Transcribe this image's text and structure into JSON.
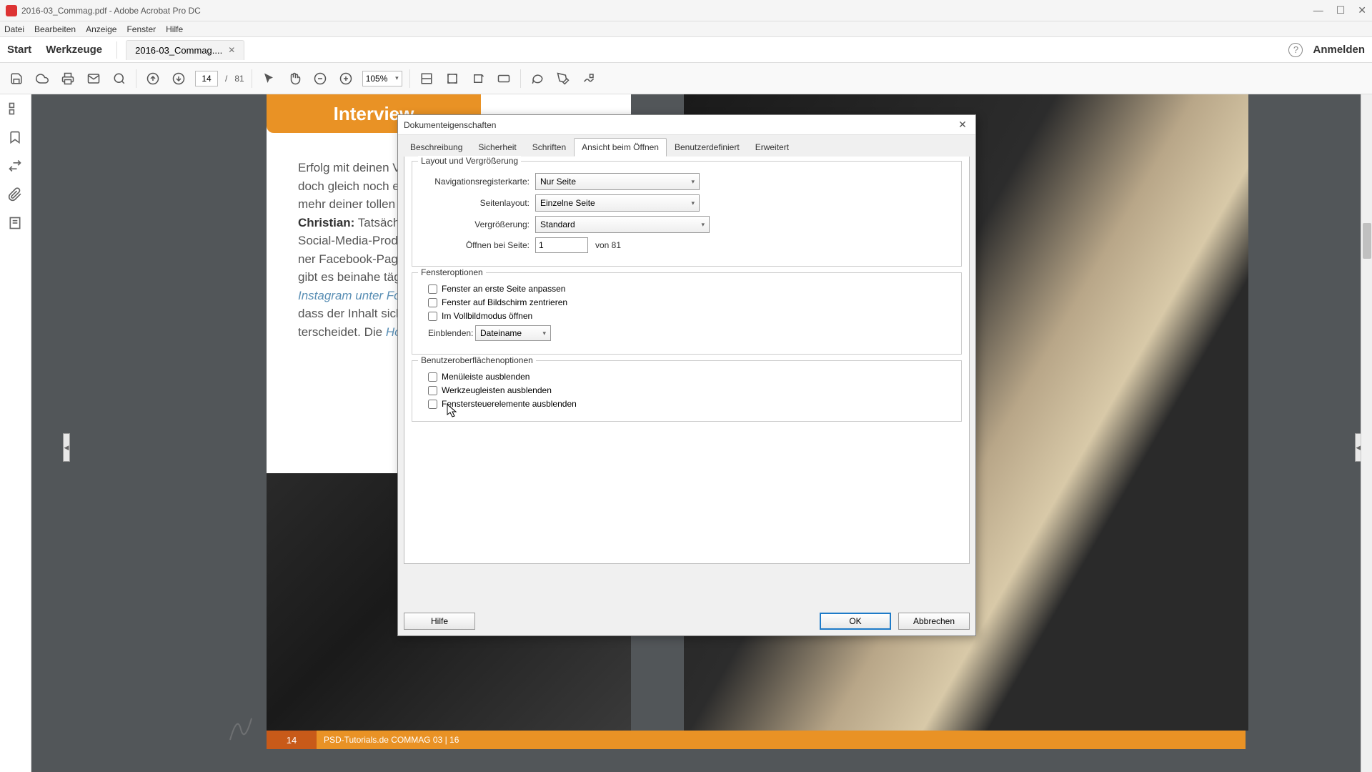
{
  "app": {
    "title": "2016-03_Commag.pdf - Adobe Acrobat Pro DC",
    "menubar": [
      "Datei",
      "Bearbeiten",
      "Anzeige",
      "Fenster",
      "Hilfe"
    ],
    "toptabs": {
      "start": "Start",
      "tools": "Werkzeuge",
      "file_tab": "2016-03_Commag....",
      "signin": "Anmelden"
    }
  },
  "toolbar": {
    "page_current": "14",
    "page_sep": "/",
    "page_total": "81",
    "zoom": "105%"
  },
  "page": {
    "tab_label": "Interview",
    "body_lines": [
      "Erfolg mit deinen Vierbeine",
      "doch gleich noch etwas W",
      "mehr deiner tollen Bilder s"
    ],
    "author_label": "Christian:",
    "after_author": " Tatsächlich ist „F",
    "lines2": [
      "Social-Media-Produkt. Am a",
      "ner Facebook-Page unter",
      "gibt es beinahe täglich neu"
    ],
    "link1": "Instagram unter FotosFreiS",
    "after_link1_a": "dass der Inhalt sich hier nicl",
    "after_link1_b": "terscheidet. Die ",
    "link2": "Homepage",
    "footer_page": "14",
    "footer_bar": "PSD-Tutorials.de   COMMAG 03 | 16"
  },
  "dialog": {
    "title": "Dokumenteigenschaften",
    "tabs": [
      "Beschreibung",
      "Sicherheit",
      "Schriften",
      "Ansicht beim Öffnen",
      "Benutzerdefiniert",
      "Erweitert"
    ],
    "active_tab_index": 3,
    "group_layout": {
      "legend": "Layout und Vergrößerung",
      "nav_label": "Navigationsregisterkarte:",
      "nav_value": "Nur Seite",
      "pagelayout_label": "Seitenlayout:",
      "pagelayout_value": "Einzelne Seite",
      "zoom_label": "Vergrößerung:",
      "zoom_value": "Standard",
      "openat_label": "Öffnen bei Seite:",
      "openat_value": "1",
      "openat_suffix": "von 81"
    },
    "group_window": {
      "legend": "Fensteroptionen",
      "chk1": "Fenster an erste Seite anpassen",
      "chk2": "Fenster auf Bildschirm zentrieren",
      "chk3": "Im Vollbildmodus öffnen",
      "show_label": "Einblenden:",
      "show_value": "Dateiname"
    },
    "group_ui": {
      "legend": "Benutzeroberflächenoptionen",
      "chk1": "Menüleiste ausblenden",
      "chk2": "Werkzeugleisten ausblenden",
      "chk3": "Fenstersteuerelemente ausblenden"
    },
    "buttons": {
      "help": "Hilfe",
      "ok": "OK",
      "cancel": "Abbrechen"
    }
  }
}
